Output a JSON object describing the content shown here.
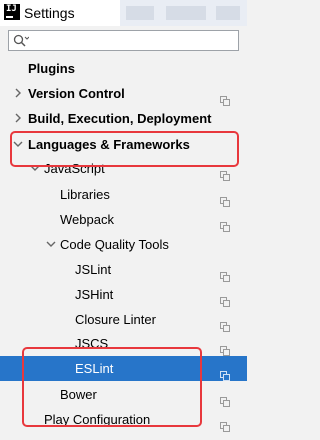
{
  "window": {
    "title": "Settings",
    "icon": "intellij-app-icon"
  },
  "search": {
    "placeholder": "",
    "value": "",
    "icon": "search-icon"
  },
  "tree": {
    "items": [
      {
        "label": "Plugins",
        "bold": true,
        "expanded": null,
        "copy_icon": false,
        "selected": false
      },
      {
        "label": "Version Control",
        "bold": true,
        "expanded": false,
        "copy_icon": true,
        "selected": false
      },
      {
        "label": "Build, Execution, Deployment",
        "bold": true,
        "expanded": false,
        "copy_icon": false,
        "selected": false
      },
      {
        "label": "Languages & Frameworks",
        "bold": true,
        "expanded": true,
        "copy_icon": false,
        "selected": false
      },
      {
        "label": "JavaScript",
        "bold": false,
        "expanded": true,
        "copy_icon": true,
        "selected": false
      },
      {
        "label": "Libraries",
        "bold": false,
        "expanded": null,
        "copy_icon": true,
        "selected": false
      },
      {
        "label": "Webpack",
        "bold": false,
        "expanded": null,
        "copy_icon": true,
        "selected": false
      },
      {
        "label": "Code Quality Tools",
        "bold": false,
        "expanded": true,
        "copy_icon": false,
        "selected": false
      },
      {
        "label": "JSLint",
        "bold": false,
        "expanded": null,
        "copy_icon": true,
        "selected": false
      },
      {
        "label": "JSHint",
        "bold": false,
        "expanded": null,
        "copy_icon": true,
        "selected": false
      },
      {
        "label": "Closure Linter",
        "bold": false,
        "expanded": null,
        "copy_icon": true,
        "selected": false
      },
      {
        "label": "JSCS",
        "bold": false,
        "expanded": null,
        "copy_icon": true,
        "selected": false
      },
      {
        "label": "ESLint",
        "bold": false,
        "expanded": null,
        "copy_icon": true,
        "selected": true
      },
      {
        "label": "Bower",
        "bold": false,
        "expanded": null,
        "copy_icon": true,
        "selected": false
      },
      {
        "label": "Play Configuration",
        "bold": false,
        "expanded": null,
        "copy_icon": true,
        "selected": false
      }
    ]
  },
  "colors": {
    "selection": "#2775c9",
    "annotation_border": "#e8383d",
    "background": "#f2f2f2"
  }
}
